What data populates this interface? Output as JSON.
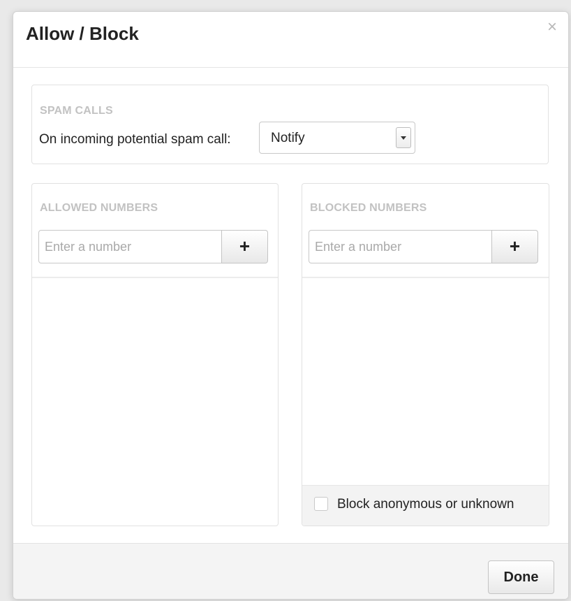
{
  "dialog": {
    "title": "Allow / Block",
    "close_glyph": "×"
  },
  "spam": {
    "heading": "SPAM CALLS",
    "label": "On incoming potential spam call:",
    "selected_option": "Notify"
  },
  "allowed": {
    "heading": "ALLOWED NUMBERS",
    "input_placeholder": "Enter a number",
    "add_glyph": "+"
  },
  "blocked": {
    "heading": "BLOCKED NUMBERS",
    "input_placeholder": "Enter a number",
    "add_glyph": "+",
    "checkbox_label": "Block anonymous or unknown"
  },
  "footer": {
    "done_label": "Done"
  },
  "icons": {
    "close": "close-icon",
    "add": "plus-icon",
    "dropdown": "chevron-down-icon"
  },
  "colors": {
    "heading_gray": "#c2c2c2",
    "text": "#222222",
    "footer_bg": "#f4f4f4"
  }
}
